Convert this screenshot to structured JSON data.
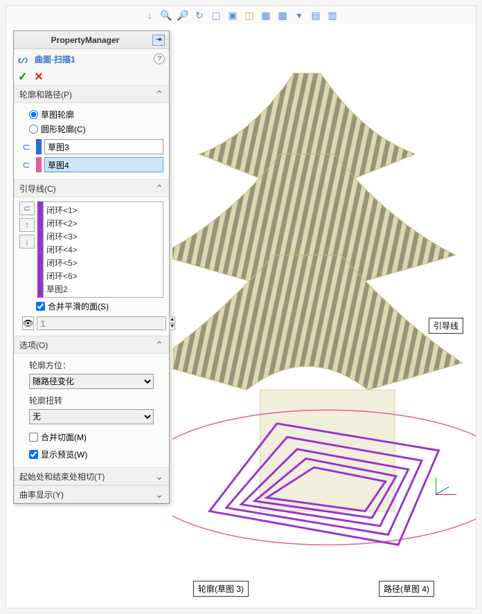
{
  "panel": {
    "title": "PropertyManager",
    "feature_name": "曲面-扫描1",
    "section_profile_path": "轮廓和路径(P)",
    "radio_sketch_profile": "草图轮廓",
    "radio_circle_profile": "圆形轮廓(C)",
    "profile_value": "草图3",
    "path_value": "草图4",
    "section_guides": "引导线(C)",
    "guides": [
      "闭环<1>",
      "闭环<2>",
      "闭环<3>",
      "闭环<4>",
      "闭环<5>",
      "闭环<6>",
      "草图2"
    ],
    "merge_smooth": "合并平滑的面(S)",
    "preview_value": "1",
    "section_options": "选项(O)",
    "opt_orientation_label": "轮廓方位：",
    "opt_orientation_value": "随路径变化",
    "opt_twist_label": "轮廓扭转",
    "opt_twist_value": "无",
    "merge_tangent": "合并切面(M)",
    "show_preview": "显示预览(W)",
    "section_startend": "起始处和结束处相切(T)",
    "section_curvature": "曲率显示(Y)"
  },
  "callouts": {
    "guide": "引导线",
    "profile": "轮廓(草图 3)",
    "path": "路径(草图 4)"
  },
  "colors": {
    "profile_tab": "#2b6cd4",
    "path_tab": "#e85a9c",
    "guide_tab": "#9933cc"
  }
}
